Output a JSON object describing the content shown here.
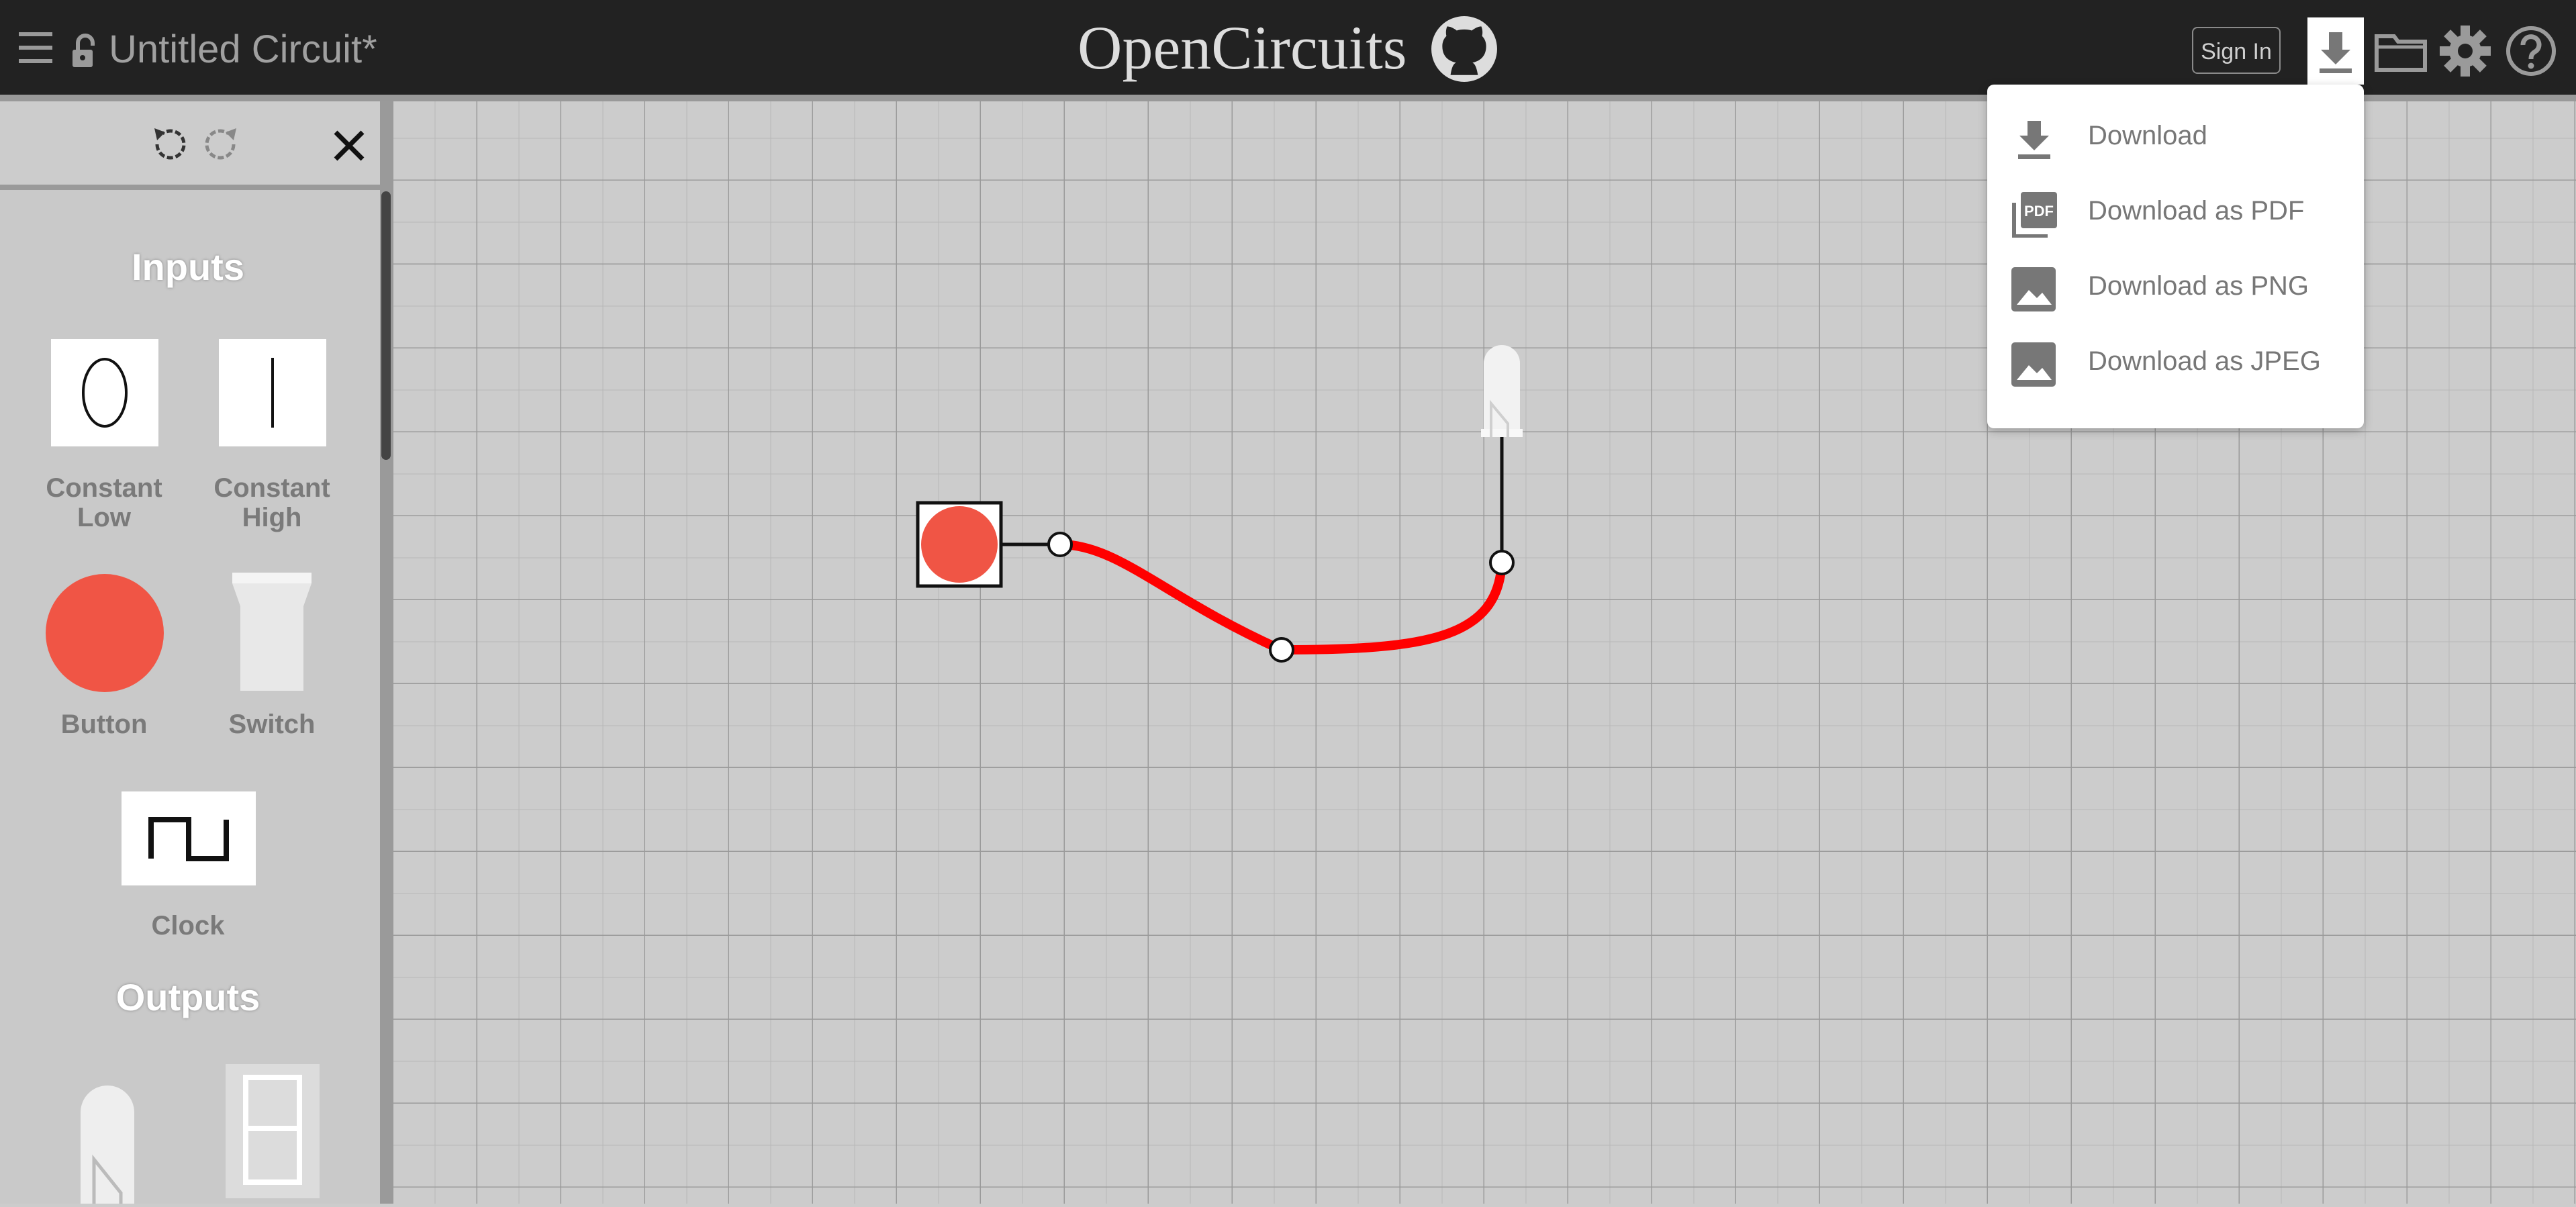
{
  "header": {
    "circuit_name": "Untitled Circuit*",
    "logo_text": "OpenCircuits",
    "sign_in_label": "Sign In",
    "icons": [
      "menu-icon",
      "lock-icon",
      "github-icon",
      "download-icon",
      "folder-icon",
      "gear-icon",
      "help-icon"
    ]
  },
  "download_menu": {
    "items": [
      {
        "label": "Download",
        "icon": "download-icon"
      },
      {
        "label": "Download as PDF",
        "icon": "pdf-icon",
        "icon_text": "PDF"
      },
      {
        "label": "Download as PNG",
        "icon": "image-icon"
      },
      {
        "label": "Download as JPEG",
        "icon": "image-icon"
      }
    ]
  },
  "sidebar": {
    "sections": [
      {
        "title": "Inputs",
        "items": [
          "Constant Low",
          "Constant High",
          "Button",
          "Switch",
          "Clock"
        ]
      },
      {
        "title": "Outputs",
        "items": []
      }
    ],
    "labels": {
      "constant_low": "Constant\nLow",
      "constant_high": "Constant\nHigh",
      "button": "Button",
      "switch": "Switch",
      "clock": "Clock"
    }
  },
  "canvas": {
    "wire_color": "#ff0000",
    "button_color": "#f05545",
    "components": [
      "Button",
      "LED"
    ]
  },
  "colors": {
    "header_bg": "#222222",
    "canvas_bg": "#cccccc",
    "grid_line": "#999999"
  }
}
